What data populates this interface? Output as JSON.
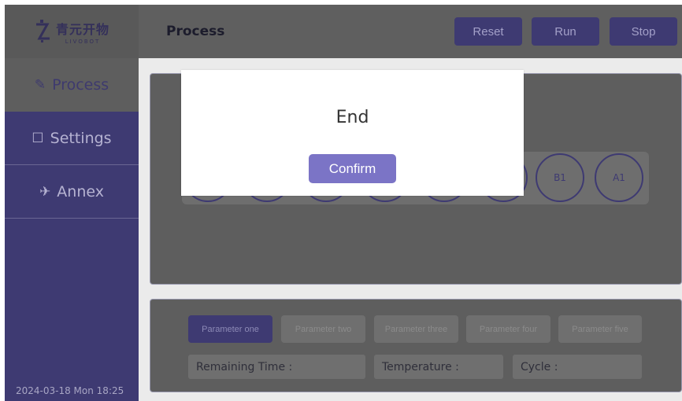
{
  "app": {
    "logo_cn": "青元开物",
    "logo_en": "LIVOBOT"
  },
  "sidebar": {
    "items": [
      {
        "label": "Process",
        "icon": "paperclip-icon",
        "glyph": "✎",
        "active": true
      },
      {
        "label": "Settings",
        "icon": "folder-icon",
        "glyph": "☐",
        "active": false
      },
      {
        "label": "Annex",
        "icon": "plane-icon",
        "glyph": "✈",
        "active": false
      }
    ],
    "datetime": "2024-03-18 Mon 18:25"
  },
  "header": {
    "title": "Process",
    "buttons": {
      "reset": "Reset",
      "run": "Run",
      "stop": "Stop"
    }
  },
  "wells": {
    "labels": [
      "",
      "",
      "",
      "",
      "",
      "",
      "B1",
      "A1"
    ]
  },
  "parameters": {
    "tabs": [
      "Parameter one",
      "Parameter two",
      "Parameter three",
      "Parameter four",
      "Parameter five"
    ],
    "active_index": 0
  },
  "status": {
    "remaining_time": "Remaining Time :",
    "temperature": "Temperature :",
    "cycle": "Cycle :"
  },
  "modal": {
    "message": "End",
    "confirm": "Confirm"
  },
  "colors": {
    "accent": "#3e3a72",
    "confirm": "#7b74c6"
  }
}
